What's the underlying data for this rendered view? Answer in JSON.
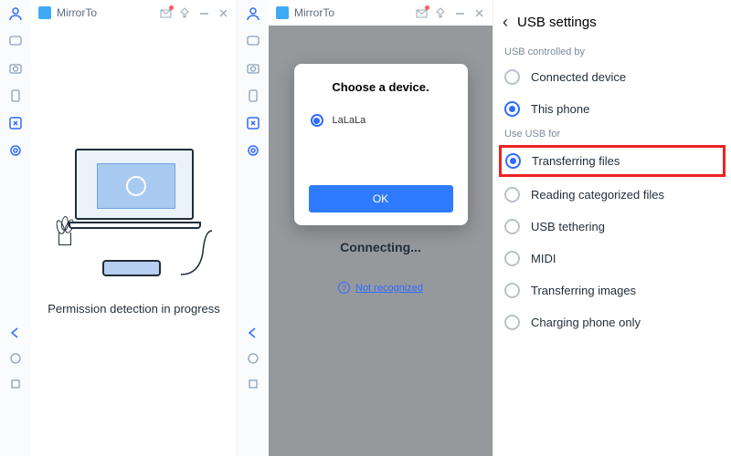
{
  "panel1": {
    "app_name": "MirrorTo",
    "status_text": "Permission detection in progress"
  },
  "panel2": {
    "app_name": "MirrorTo",
    "dialog_title": "Choose a device.",
    "device_name": "LaLaLa",
    "ok_label": "OK",
    "connecting_text": "Connecting...",
    "not_recognized": "Not recognized"
  },
  "panel3": {
    "title": "USB settings",
    "section1_label": "USB controlled by",
    "section1_options": [
      "Connected device",
      "This phone"
    ],
    "section1_selected": 1,
    "section2_label": "Use USB for",
    "section2_options": [
      "Transferring files",
      "Reading categorized files",
      "USB tethering",
      "MIDI",
      "Transferring images",
      "Charging phone only"
    ],
    "section2_selected": 0
  }
}
